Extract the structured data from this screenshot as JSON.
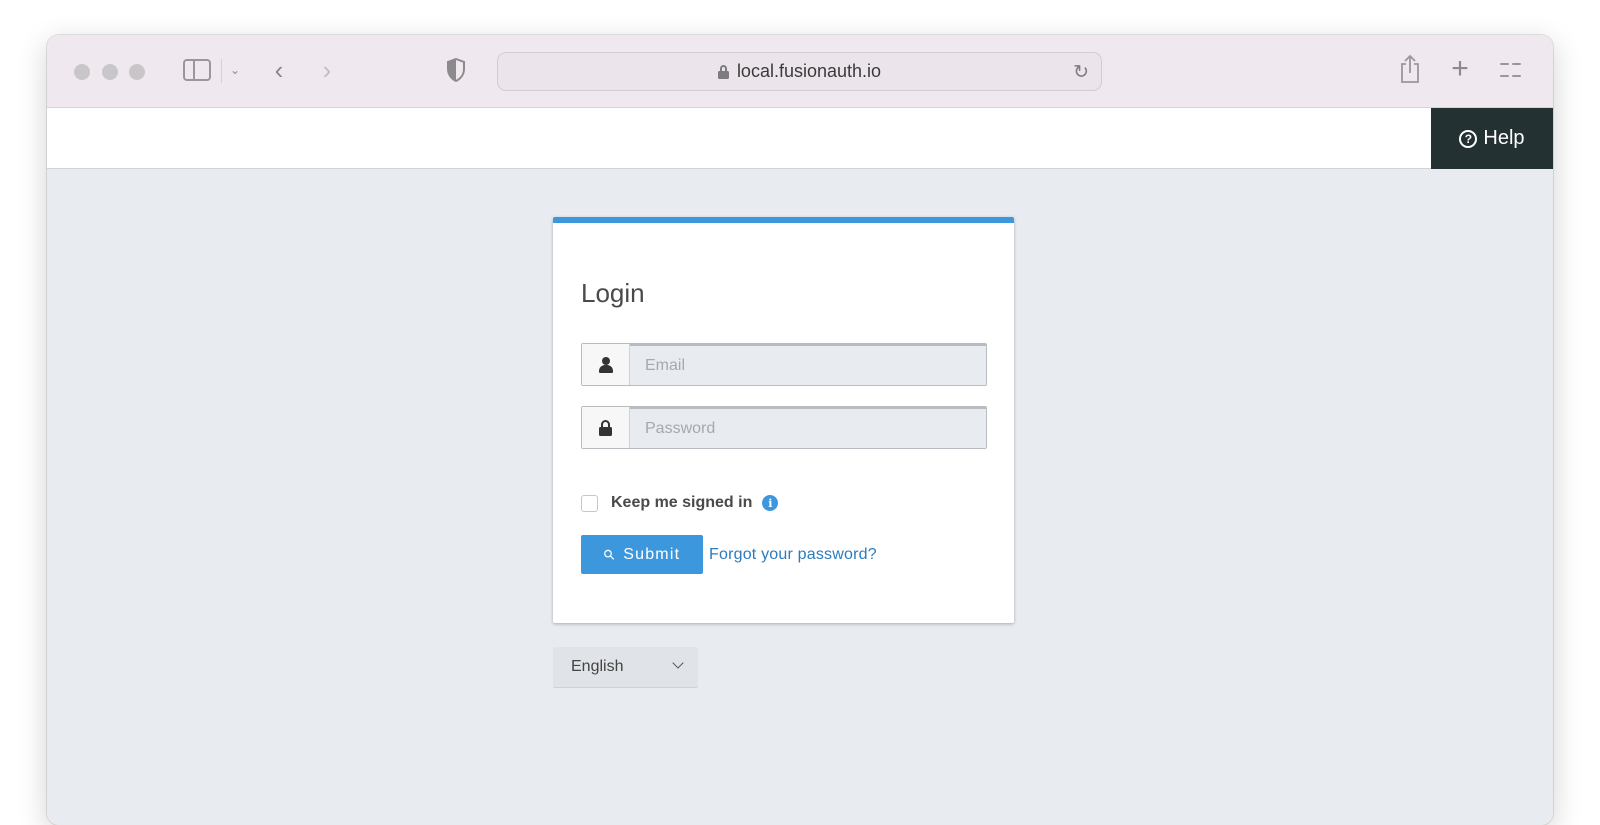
{
  "browser": {
    "url": "local.fusionauth.io",
    "icons": {
      "traffic_lights": [
        "close-dot",
        "minimize-dot",
        "zoom-dot"
      ],
      "sidebar": "sidebar-icon",
      "tab_group_menu": "chevron-down-icon",
      "back": "chevron-left-icon",
      "forward": "chevron-right-icon",
      "privacy": "shield-icon",
      "secure": "lock-icon",
      "reload": "reload-icon",
      "share": "share-icon",
      "new_tab": "plus-icon",
      "tab_overview": "grid-icon"
    },
    "glyphs": {
      "chevron_down": "⌄",
      "back": "‹",
      "forward": "›",
      "reload": "↻",
      "plus": "+"
    }
  },
  "header": {
    "help_label": "Help",
    "help_icon_glyph": "?"
  },
  "login": {
    "title": "Login",
    "email": {
      "placeholder": "Email",
      "value": ""
    },
    "password": {
      "placeholder": "Password",
      "value": ""
    },
    "remember_me": {
      "label": "Keep me signed in",
      "checked": false,
      "info_glyph": "i"
    },
    "submit_label": "Submit",
    "submit_icon_glyph": "⚲",
    "forgot_password_label": "Forgot your password?"
  },
  "language": {
    "selected": "English"
  },
  "colors": {
    "accent": "#3d97dc",
    "link": "#2b7bbd",
    "help_bg": "#243132",
    "page_bg": "#e8ecf0"
  }
}
